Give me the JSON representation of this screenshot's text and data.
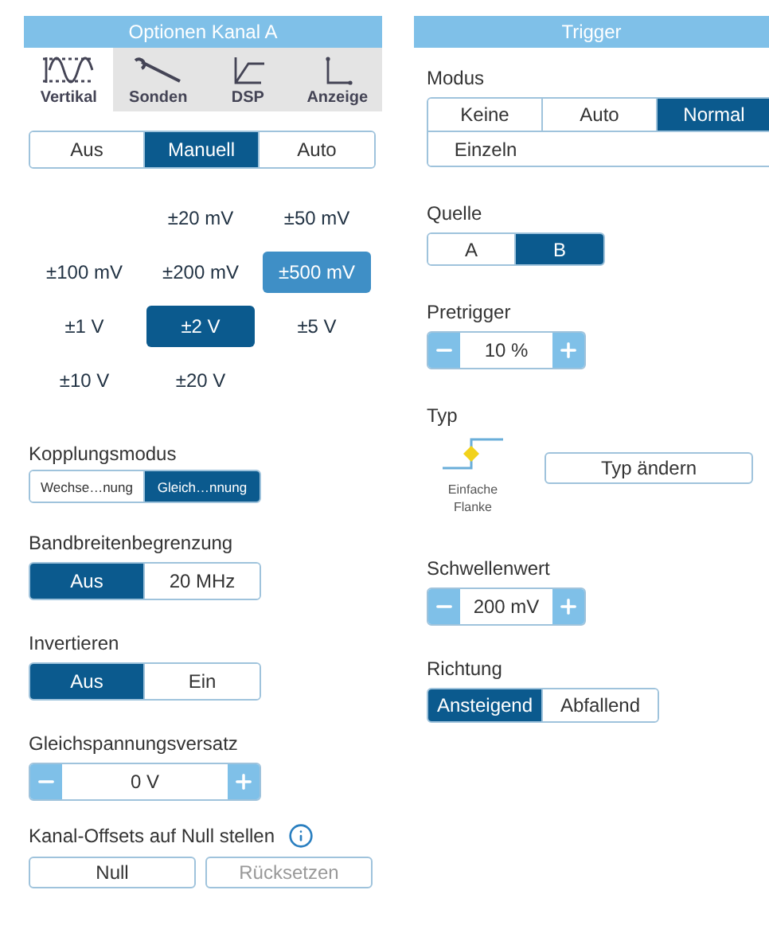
{
  "channel_panel": {
    "title": "Optionen Kanal A",
    "tabs": [
      {
        "label": "Vertikal",
        "kind": "vertical",
        "selected": true
      },
      {
        "label": "Sonden",
        "kind": "probe",
        "selected": false
      },
      {
        "label": "DSP",
        "kind": "dsp",
        "selected": false
      },
      {
        "label": "Anzeige",
        "kind": "display",
        "selected": false
      }
    ],
    "range_mode": [
      {
        "label": "Aus",
        "selected": false
      },
      {
        "label": "Manuell",
        "selected": true
      },
      {
        "label": "Auto",
        "selected": false
      }
    ],
    "ranges": [
      {
        "label": "±20 mV",
        "selected": false,
        "highlighted": false
      },
      {
        "label": "±50 mV",
        "selected": false,
        "highlighted": false
      },
      {
        "label": "±100 mV",
        "selected": false,
        "highlighted": false
      },
      {
        "label": "±200 mV",
        "selected": false,
        "highlighted": false
      },
      {
        "label": "±500 mV",
        "selected": false,
        "highlighted": true
      },
      {
        "label": "±1 V",
        "selected": false,
        "highlighted": false
      },
      {
        "label": "±2 V",
        "selected": true,
        "highlighted": false
      },
      {
        "label": "±5 V",
        "selected": false,
        "highlighted": false
      },
      {
        "label": "±10 V",
        "selected": false,
        "highlighted": false
      },
      {
        "label": "±20 V",
        "selected": false,
        "highlighted": false
      }
    ],
    "coupling": {
      "label": "Kopplungsmodus",
      "options": [
        {
          "label": "Wechse…nung",
          "selected": false
        },
        {
          "label": "Gleich…nnung",
          "selected": true
        }
      ]
    },
    "bandwidth": {
      "label": "Bandbreitenbegrenzung",
      "options": [
        {
          "label": "Aus",
          "selected": true
        },
        {
          "label": "20 MHz",
          "selected": false
        }
      ]
    },
    "invert": {
      "label": "Invertieren",
      "options": [
        {
          "label": "Aus",
          "selected": true
        },
        {
          "label": "Ein",
          "selected": false
        }
      ]
    },
    "offset": {
      "label": "Gleichspannungsversatz",
      "value": "0 V"
    },
    "zero_offsets": {
      "label": "Kanal-Offsets auf Null stellen",
      "buttons": [
        {
          "label": "Null",
          "disabled": false
        },
        {
          "label": "Rücksetzen",
          "disabled": true
        }
      ]
    }
  },
  "trigger_panel": {
    "title": "Trigger",
    "mode": {
      "label": "Modus",
      "options": [
        {
          "label": "Keine",
          "selected": false
        },
        {
          "label": "Auto",
          "selected": false
        },
        {
          "label": "Normal",
          "selected": true
        },
        {
          "label": "Einzeln",
          "selected": false
        }
      ]
    },
    "source": {
      "label": "Quelle",
      "options": [
        {
          "label": "A",
          "selected": false
        },
        {
          "label": "B",
          "selected": true
        }
      ]
    },
    "pretrigger": {
      "label": "Pretrigger",
      "value": "10 %"
    },
    "type": {
      "label": "Typ",
      "name": "Einfache Flanke",
      "button": "Typ ändern"
    },
    "threshold": {
      "label": "Schwellenwert",
      "value": "200 mV"
    },
    "direction": {
      "label": "Richtung",
      "options": [
        {
          "label": "Ansteigend",
          "selected": true
        },
        {
          "label": "Abfallend",
          "selected": false
        }
      ]
    }
  }
}
